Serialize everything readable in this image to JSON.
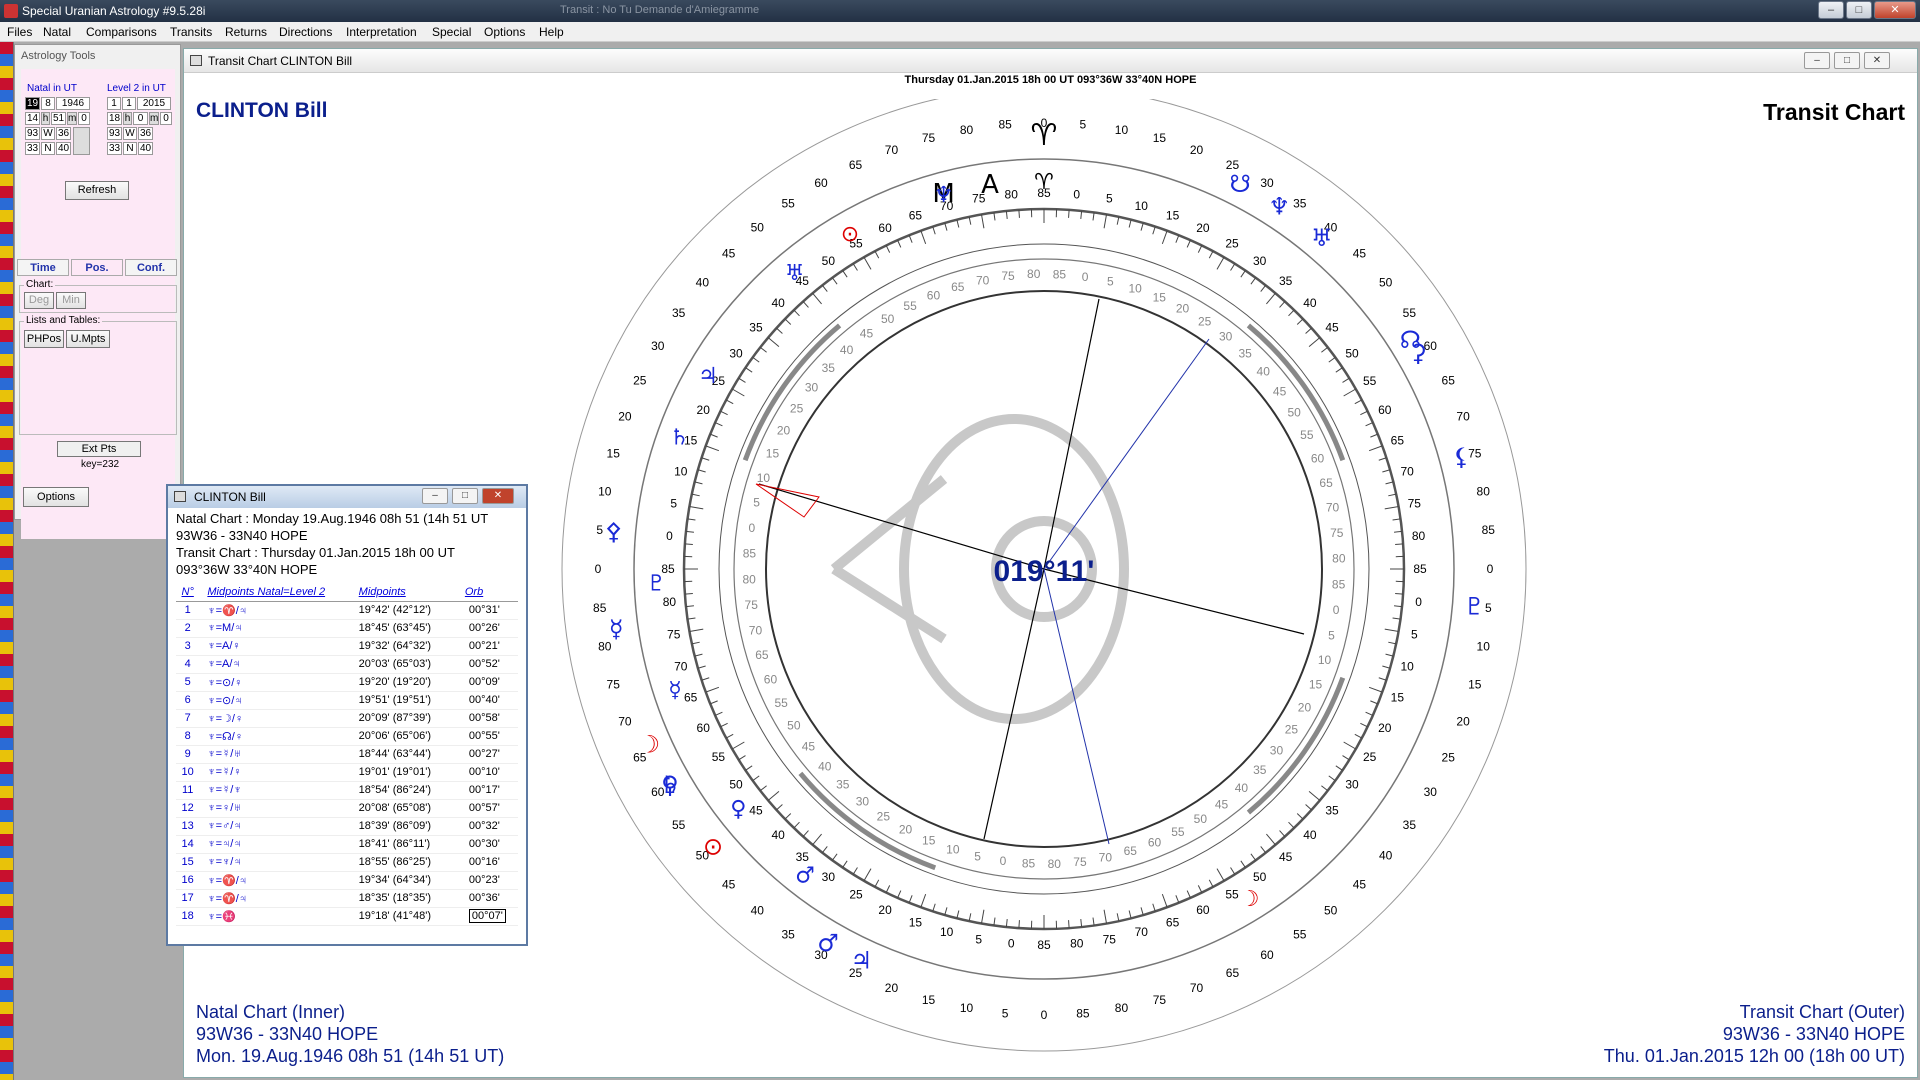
{
  "app": {
    "title": "Special Uranian Astrology #9.5.28i",
    "blurred_title": "Transit : No Tu Demande d'Amiegramme",
    "window_controls": [
      "–",
      "□",
      "✕"
    ]
  },
  "menu": [
    "Files",
    "Natal",
    "Comparisons",
    "Transits",
    "Returns",
    "Directions",
    "Interpretation",
    "Special",
    "Options",
    "Help"
  ],
  "tools": {
    "title": "Astrology Tools",
    "natal_label": "Natal in UT",
    "level2_label": "Level 2 in UT",
    "natal": {
      "day": "19",
      "month": "8",
      "year": "1946",
      "hour": "14",
      "h": "h",
      "min": "51",
      "m": "m",
      "sec": "0",
      "lon_deg": "93",
      "lon_dir": "W",
      "lon_min": "36",
      "lat_deg": "33",
      "lat_dir": "N",
      "lat_min": "40"
    },
    "level2": {
      "day": "1",
      "month": "1",
      "year": "2015",
      "hour": "18",
      "h": "h",
      "min": "0",
      "m": "m",
      "sec": "0",
      "lon_deg": "93",
      "lon_dir": "W",
      "lon_min": "36",
      "lat_deg": "33",
      "lat_dir": "N",
      "lat_min": "40"
    },
    "refresh": "Refresh",
    "tabs": [
      "Time",
      "Pos.",
      "Conf."
    ],
    "chart_group": "Chart:",
    "deg": "Deg",
    "min": "Min",
    "lists_group": "Lists and Tables:",
    "phpos": "PHPos",
    "umpts": "U.Mpts",
    "ext_pts": "Ext Pts",
    "key": "key=232",
    "options": "Options"
  },
  "chart_window": {
    "caption": "Transit Chart  CLINTON Bill",
    "header": "Thursday 01.Jan.2015 18h 00 UT 093°36W 33°40N  HOPE",
    "name": "CLINTON Bill",
    "type": "Transit Chart",
    "center_label": "019°11'",
    "foot_left": [
      "Natal Chart (Inner)",
      "93W36 - 33N40  HOPE",
      "Mon. 19.Aug.1946 08h 51 (14h 51 UT)"
    ],
    "foot_right": [
      "Transit Chart (Outer)",
      "93W36 - 33N40  HOPE",
      "Thu. 01.Jan.2015 12h 00 (18h 00 UT)"
    ],
    "outer_ring_numbers": [
      "0",
      "5",
      "10",
      "15",
      "20",
      "25",
      "30",
      "35",
      "40",
      "45",
      "50",
      "55",
      "60",
      "65",
      "70",
      "75",
      "80",
      "85"
    ],
    "middle_ring_numbers": [
      "0",
      "5",
      "10",
      "15",
      "20",
      "25",
      "30",
      "35",
      "40",
      "45",
      "50",
      "55",
      "60",
      "65",
      "70",
      "75",
      "80",
      "85"
    ],
    "inner_ring_numbers": [
      "0",
      "5",
      "10",
      "15",
      "20",
      "25",
      "30",
      "35",
      "40",
      "45",
      "50",
      "55",
      "60",
      "65",
      "70",
      "75",
      "80",
      "85"
    ],
    "outer_symbols": [
      "♈",
      "☋",
      "♆",
      "♅",
      "☊",
      "♄",
      "☽",
      "♂",
      "♃",
      "☿",
      "♀",
      "⊙",
      "♇",
      "⚸",
      "⚳",
      "⚴"
    ],
    "inner_symbols": [
      "M",
      "A",
      "♈",
      "⊙",
      "☽",
      "♃",
      "♄",
      "♇",
      "☿",
      "♀",
      "♂",
      "♆",
      "♅"
    ]
  },
  "popup": {
    "title": "CLINTON Bill",
    "info": [
      "Natal Chart : Monday 19.Aug.1946 08h 51 (14h 51 UT",
      "93W36 - 33N40  HOPE",
      "Transit Chart : Thursday 01.Jan.2015 18h 00 UT",
      "093°36W 33°40N  HOPE"
    ],
    "headers": {
      "n": "N°",
      "formula": "Midpoints Natal=Level 2",
      "mp": "Midpoints",
      "orb": "Orb"
    },
    "rows": [
      {
        "n": "1",
        "formula": "♆=♈/♃",
        "mp": "19°42' (42°12')",
        "orb": "00°31'"
      },
      {
        "n": "2",
        "formula": "♆=M/♃",
        "mp": "18°45' (63°45')",
        "orb": "00°26'"
      },
      {
        "n": "3",
        "formula": "♆=A/♀",
        "mp": "19°32' (64°32')",
        "orb": "00°21'"
      },
      {
        "n": "4",
        "formula": "♆=A/♃",
        "mp": "20°03' (65°03')",
        "orb": "00°52'"
      },
      {
        "n": "5",
        "formula": "♆=⊙/♀",
        "mp": "19°20' (19°20')",
        "orb": "00°09'"
      },
      {
        "n": "6",
        "formula": "♆=⊙/♃",
        "mp": "19°51' (19°51')",
        "orb": "00°40'"
      },
      {
        "n": "7",
        "formula": "♆=☽/♀",
        "mp": "20°09' (87°39')",
        "orb": "00°58'"
      },
      {
        "n": "8",
        "formula": "♆=☊/♀",
        "mp": "20°06' (65°06')",
        "orb": "00°55'"
      },
      {
        "n": "9",
        "formula": "♆=☿/♅",
        "mp": "18°44' (63°44')",
        "orb": "00°27'"
      },
      {
        "n": "10",
        "formula": "♆=☿/♀",
        "mp": "19°01' (19°01')",
        "orb": "00°10'"
      },
      {
        "n": "11",
        "formula": "♆=☿/♆",
        "mp": "18°54' (86°24')",
        "orb": "00°17'"
      },
      {
        "n": "12",
        "formula": "♆=♀/♅",
        "mp": "20°08' (65°08')",
        "orb": "00°57'"
      },
      {
        "n": "13",
        "formula": "♆=♂/♃",
        "mp": "18°39' (86°09')",
        "orb": "00°32'"
      },
      {
        "n": "14",
        "formula": "♆=♃/♃",
        "mp": "18°41' (86°11')",
        "orb": "00°30'"
      },
      {
        "n": "15",
        "formula": "♆=♆/♃",
        "mp": "18°55' (86°25')",
        "orb": "00°16'"
      },
      {
        "n": "16",
        "formula": "♆=♈/♃",
        "mp": "19°34' (64°34')",
        "orb": "00°23'"
      },
      {
        "n": "17",
        "formula": "♆=♈/♃",
        "mp": "18°35' (18°35')",
        "orb": "00°36'"
      },
      {
        "n": "18",
        "formula": "♆=♓",
        "mp": "19°18' (41°48')",
        "orb": "00°07'"
      }
    ]
  }
}
